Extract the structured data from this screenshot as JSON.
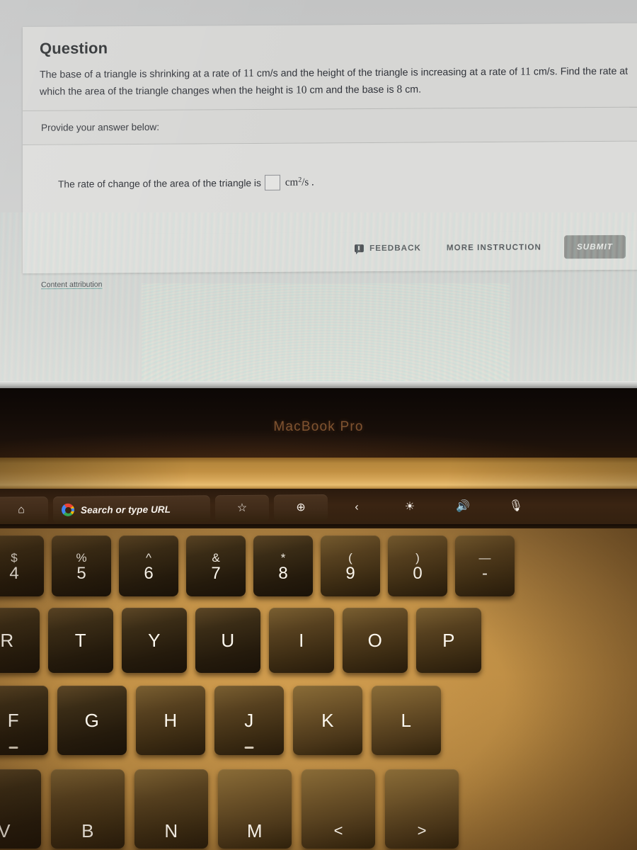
{
  "question": {
    "heading": "Question",
    "body_part1": "The base of a triangle is shrinking at a rate of ",
    "rate1": "11",
    "body_part2": " cm/s and the height of the triangle is increasing at a rate of ",
    "rate2": "11",
    "body_part3": " cm/s. Find the rate at which the area of the triangle changes when the height is ",
    "height_val": "10",
    "body_part4": " cm and the base is ",
    "base_val": "8",
    "body_part5": " cm.",
    "provide_label": "Provide your answer below:",
    "answer_prompt": "The rate of change of the area of the triangle is",
    "answer_value": "",
    "unit_base": "cm",
    "unit_exponent": "2",
    "unit_denominator": "/s",
    "unit_period": ".",
    "attribution_link": "Content attribution"
  },
  "buttons": {
    "feedback": "FEEDBACK",
    "more_instruction": "MORE INSTRUCTION",
    "submit": "SUBMIT"
  },
  "laptop": {
    "brand_label": "MacBook Pro"
  },
  "touchbar": {
    "home_icon": "⌂",
    "search_placeholder": "Search or type URL",
    "star_icon": "☆",
    "plus_icon": "⊕",
    "back_icon": "‹",
    "brightness_icon": "☀",
    "volume_icon": "🔊",
    "mic_icon": "🎙"
  },
  "keyboard": {
    "row_number": [
      {
        "top": "$",
        "bottom": "4"
      },
      {
        "top": "%",
        "bottom": "5"
      },
      {
        "top": "^",
        "bottom": "6"
      },
      {
        "top": "&",
        "bottom": "7"
      },
      {
        "top": "*",
        "bottom": "8"
      },
      {
        "top": "(",
        "bottom": "9"
      },
      {
        "top": ")",
        "bottom": "0"
      },
      {
        "top": "—",
        "bottom": "-"
      }
    ],
    "row_qwerty": [
      "R",
      "T",
      "Y",
      "U",
      "I",
      "O",
      "P"
    ],
    "row_home": [
      "F",
      "G",
      "H",
      "J",
      "K",
      "L"
    ],
    "row_bottom": [
      "V",
      "B",
      "N",
      "M",
      "<",
      ">"
    ]
  },
  "colors": {
    "page_bg": "#c9c9c9",
    "card_bg": "#d6d6d4",
    "answer_bg": "#dcdcda",
    "submit_bg": "#8e8f8d",
    "link_underline": "#6c9e9a",
    "keyboard_deck": "#c08f45",
    "bezel": "#120b07"
  }
}
